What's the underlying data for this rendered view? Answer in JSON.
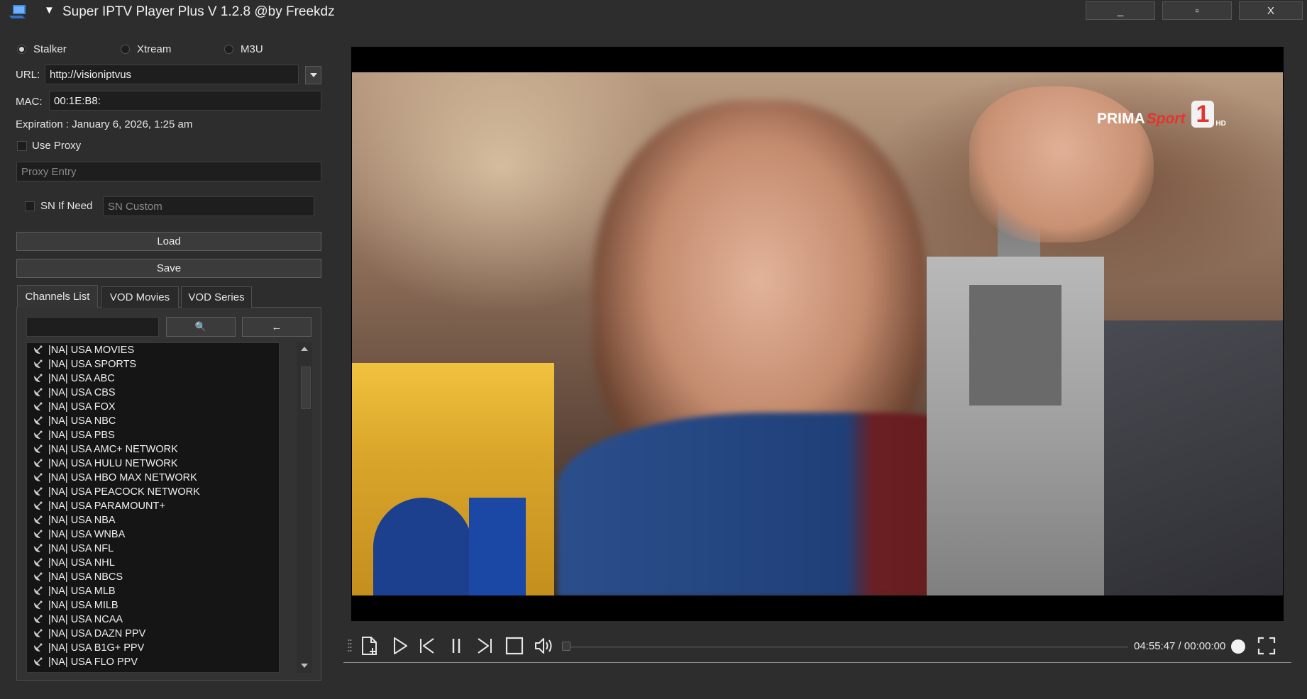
{
  "window": {
    "title": "Super IPTV Player Plus V 1.2.8 @by Freekdz",
    "menu_arrow": "▼",
    "minimize_label": "_",
    "maximize_label": "▫",
    "close_label": "X"
  },
  "connection": {
    "modes": [
      {
        "label": "Stalker",
        "selected": true
      },
      {
        "label": "Xtream",
        "selected": false
      },
      {
        "label": "M3U",
        "selected": false
      }
    ],
    "url_label": "URL:",
    "url_value": "http://visioniptvus",
    "mac_label": "MAC:",
    "mac_value": "00:1E:B8:",
    "expiration": "Expiration : January 6, 2026, 1:25 am",
    "use_proxy_label": "Use Proxy",
    "proxy_placeholder": "Proxy Entry",
    "sn_label": "SN If Need",
    "sn_placeholder": "SN Custom",
    "load_label": "Load",
    "save_label": "Save"
  },
  "tabs": [
    {
      "label": "Channels List",
      "active": true
    },
    {
      "label": "VOD Movies",
      "active": false
    },
    {
      "label": "VOD Series",
      "active": false
    }
  ],
  "search": {
    "value": "",
    "search_icon": "🔍",
    "back_label": "←"
  },
  "channels": [
    "|NA| USA MOVIES",
    "|NA| USA SPORTS",
    "|NA| USA ABC",
    "|NA| USA CBS",
    "|NA| USA FOX",
    "|NA| USA NBC",
    "|NA| USA PBS",
    "|NA| USA AMC+ NETWORK",
    "|NA| USA HULU NETWORK",
    "|NA| USA HBO MAX NETWORK",
    "|NA| USA PEACOCK NETWORK",
    "|NA| USA PARAMOUNT+",
    "|NA| USA NBA",
    "|NA| USA WNBA",
    "|NA| USA NFL",
    "|NA| USA NHL",
    "|NA| USA NBCS",
    "|NA| USA MLB",
    "|NA| USA MILB",
    "|NA| USA NCAA",
    "|NA| USA DAZN PPV",
    "|NA| USA B1G+ PPV",
    "|NA| USA FLO PPV"
  ],
  "player": {
    "logo_main": "PRIMA",
    "logo_accent": "Sport",
    "logo_number": "1",
    "logo_hd": "HD",
    "time_display": "04:55:47 / 00:00:00"
  },
  "colors": {
    "background": "#2d2d2d",
    "field": "#1e1e1e",
    "list": "#151515",
    "logo_accent": "#e3342f"
  }
}
